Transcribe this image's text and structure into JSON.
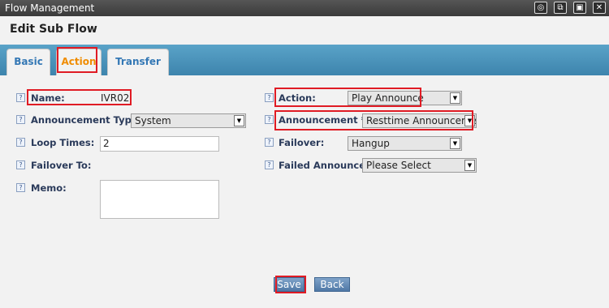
{
  "window": {
    "title": "Flow Management",
    "controls": [
      "◎",
      "⧉",
      "▣",
      "✕"
    ]
  },
  "page_title": "Edit Sub Flow",
  "tabs": [
    {
      "label": "Basic",
      "active": false
    },
    {
      "label": "Action",
      "active": true
    },
    {
      "label": "Transfer",
      "active": false
    }
  ],
  "help_glyph": "?",
  "form": {
    "name_label": "Name:",
    "name_value": "IVR02",
    "announcement_type_label": "Announcement Type:",
    "announcement_type_value": "System",
    "loop_times_label": "Loop Times:",
    "loop_times_value": "2",
    "failover_to_label": "Failover To:",
    "memo_label": "Memo:",
    "memo_value": "",
    "action_label": "Action:",
    "action_value": "Play Announce",
    "announcement_label": "Announcement *:",
    "announcement_value": "Resttime Announceme",
    "failover_label": "Failover:",
    "failover_value": "Hangup",
    "failed_announce_label": "Failed Announce:",
    "failed_announce_value": "Please Select"
  },
  "buttons": {
    "save": "Save",
    "back": "Back"
  },
  "dropdown_arrow": "▼",
  "colors": {
    "highlight": "#e01b24",
    "accent_tab": "#f08c00",
    "tab_bar": "#4a90b8"
  }
}
